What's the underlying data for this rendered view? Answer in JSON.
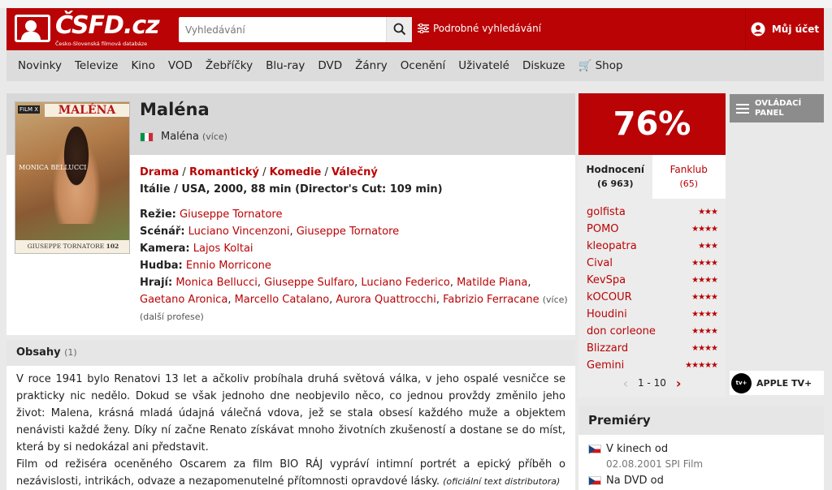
{
  "header": {
    "logo_text": "ČSFD.cz",
    "logo_sub": "Česko-Slovenská filmová databáze",
    "search_placeholder": "Vyhledávání",
    "advanced_search": "Podrobné vyhledávání",
    "account": "Můj účet"
  },
  "nav": [
    "Novinky",
    "Televize",
    "Kino",
    "VOD",
    "Žebříčky",
    "Blu-ray",
    "DVD",
    "Žánry",
    "Ocenění",
    "Uživatelé",
    "Diskuze",
    "Shop"
  ],
  "film": {
    "title": "Maléna",
    "original_title": "Maléna",
    "more": "(více)",
    "genres": [
      "Drama",
      "Romantický",
      "Komedie",
      "Válečný"
    ],
    "origin": "Itálie / USA, 2000, 88 min (Director's Cut: 109 min)",
    "poster": {
      "brand": "FILM X",
      "title": "MALÉNA",
      "actor": "MONICA BELLUCCI",
      "director": "GIUSEPPE TORNATORE",
      "number": "102"
    },
    "creators": {
      "rezie_label": "Režie:",
      "rezie": [
        "Giuseppe Tornatore"
      ],
      "scenar_label": "Scénář:",
      "scenar": [
        "Luciano Vincenzoni",
        "Giuseppe Tornatore"
      ],
      "kamera_label": "Kamera:",
      "kamera": [
        "Lajos Koltai"
      ],
      "hudba_label": "Hudba:",
      "hudba": [
        "Ennio Morricone"
      ],
      "hraji_label": "Hrají:",
      "hraji": [
        "Monica Bellucci",
        "Giuseppe Sulfaro",
        "Luciano Federico",
        "Matilde Piana",
        "Gaetano Aronica",
        "Marcello Catalano",
        "Aurora Quattrocchi",
        "Fabrizio Ferracane"
      ],
      "hraji_more": "(více)",
      "dalsi": "(další profese)"
    }
  },
  "plot": {
    "title": "Obsahy",
    "count": "(1)",
    "p1": "V roce 1941 bylo Renatovi 13 let a ačkoliv probíhala druhá světová válka, v jeho ospalé vesničce se prakticky nic nedělo. Dokud se však jednoho dne neobjevilo něco, co jednou provždy změnilo jeho život: Malena, krásná mladá údajná válečná vdova, jež se stala obsesí každého muže a objektem nenávisti každé ženy. Díky ní začne Renato získávat mnoho životních zkušeností a dostane se do míst, která by si nedokázal ani představit.",
    "p2": "Film od režiséra oceněného Oscarem za film BIO RÁJ vypráví intimní portrét a epický příběh o nezávislosti, intrikách, odvaze a nezapomenutelné přítomnosti opravdové lásky.",
    "source": "(oficiální text distributora)"
  },
  "rating": {
    "percent": "76%",
    "tab_ratings": "Hodnocení",
    "tab_ratings_count": "(6 963)",
    "tab_fanclub": "Fanklub",
    "tab_fanclub_count": "(65)",
    "users": [
      {
        "name": "golfista",
        "stars": "★★★"
      },
      {
        "name": "POMO",
        "stars": "★★★★"
      },
      {
        "name": "kleopatra",
        "stars": "★★★"
      },
      {
        "name": "Cival",
        "stars": "★★★★"
      },
      {
        "name": "KevSpa",
        "stars": "★★★★"
      },
      {
        "name": "kOCOUR",
        "stars": "★★★★"
      },
      {
        "name": "Houdini",
        "stars": "★★★★"
      },
      {
        "name": "don corleone",
        "stars": "★★★★"
      },
      {
        "name": "Blizzard",
        "stars": "★★★★"
      },
      {
        "name": "Gemini",
        "stars": "★★★★★"
      }
    ],
    "pager": "1 - 10"
  },
  "sidebar": {
    "control_panel": "OVLÁDACÍ PANEL",
    "apple_tv": "APPLE TV+",
    "apple_tv_badge": "tv+"
  },
  "premiery": {
    "title": "Premiéry",
    "row1": "V kinech od",
    "row1_date": "02.08.2001 SPI Film",
    "row2": "Na DVD od"
  },
  "colors": {
    "brand": "#ba0305",
    "bg": "#e9e9e9"
  }
}
